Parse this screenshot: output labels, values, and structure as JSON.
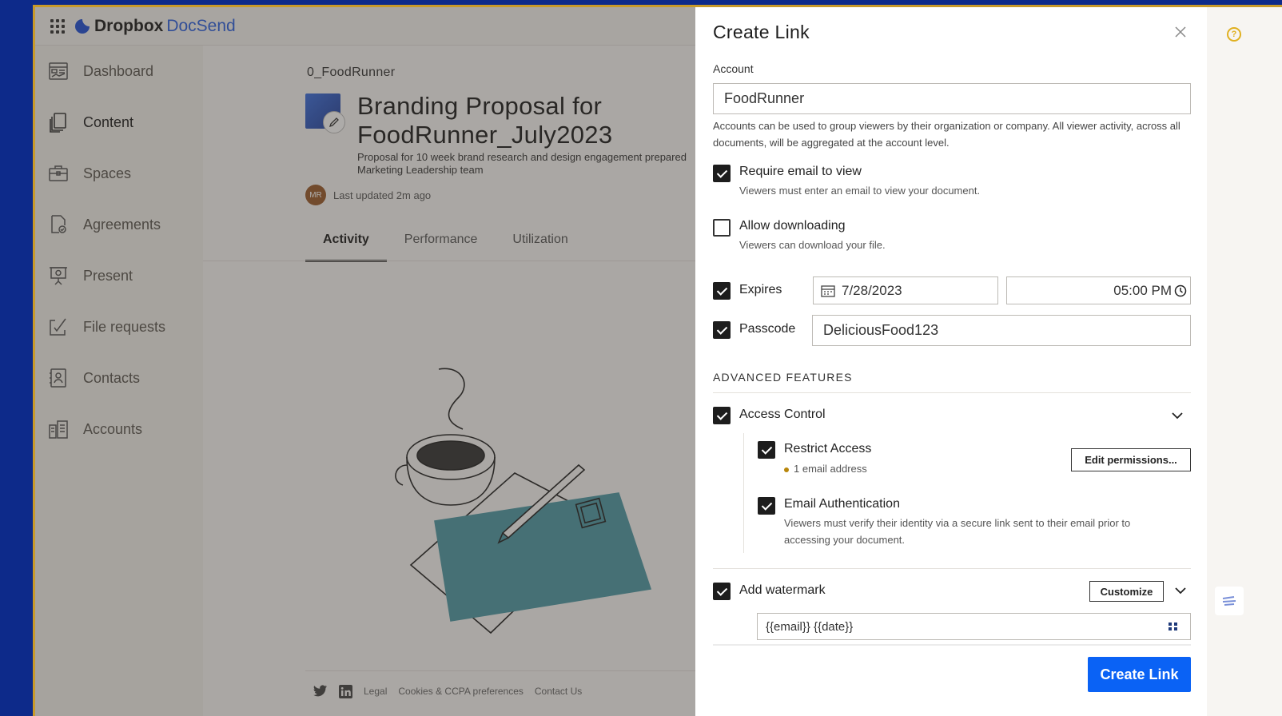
{
  "brand": {
    "name_bold": "Dropbox",
    "name_product": "DocSend",
    "accent": "#2a5fe0"
  },
  "sidebar": {
    "items": [
      {
        "label": "Dashboard",
        "icon": "dashboard-icon"
      },
      {
        "label": "Content",
        "icon": "content-icon",
        "active": true
      },
      {
        "label": "Spaces",
        "icon": "briefcase-icon"
      },
      {
        "label": "Agreements",
        "icon": "agreement-icon"
      },
      {
        "label": "Present",
        "icon": "present-icon"
      },
      {
        "label": "File requests",
        "icon": "file-request-icon"
      },
      {
        "label": "Contacts",
        "icon": "contacts-icon"
      },
      {
        "label": "Accounts",
        "icon": "accounts-icon"
      }
    ]
  },
  "document": {
    "breadcrumb": "0_FoodRunner",
    "title_line1": "Branding Proposal for",
    "title_line2": "FoodRunner_July2023",
    "description_line1": "Proposal for 10 week brand research and design engagement prepared",
    "description_line2": "Marketing Leadership team",
    "avatar_initials": "MR",
    "updated": "Last updated 2m ago",
    "tabs": [
      "Activity",
      "Performance",
      "Utilization"
    ]
  },
  "footer": {
    "links": [
      "Legal",
      "Cookies & CCPA preferences",
      "Contact Us"
    ]
  },
  "modal": {
    "title": "Create Link",
    "account_label": "Account",
    "account_value": "FoodRunner",
    "account_help": "Accounts can be used to group viewers by their organization or company. All viewer activity, across all documents, will be aggregated at the account level.",
    "require_email": {
      "label": "Require email to view",
      "help": "Viewers must enter an email to view your document.",
      "checked": true
    },
    "allow_download": {
      "label": "Allow downloading",
      "help": "Viewers can download your file.",
      "checked": false
    },
    "expires": {
      "label": "Expires",
      "date": "7/28/2023",
      "time": "05:00 PM",
      "checked": true
    },
    "passcode": {
      "label": "Passcode",
      "value": "DeliciousFood123",
      "checked": true
    },
    "advanced_heading": "ADVANCED FEATURES",
    "access_control": {
      "label": "Access Control",
      "checked": true
    },
    "restrict_access": {
      "label": "Restrict Access",
      "detail": "1 email address",
      "button": "Edit permissions...",
      "checked": true
    },
    "email_auth": {
      "label": "Email Authentication",
      "help": "Viewers must verify their identity via a secure link sent to their email prior to accessing your document.",
      "checked": true
    },
    "watermark": {
      "label": "Add watermark",
      "button": "Customize",
      "value": "{{email}} {{date}}",
      "checked": true
    },
    "submit": "Create Link",
    "primary_color": "#0a62f5"
  },
  "help_badge": "?"
}
